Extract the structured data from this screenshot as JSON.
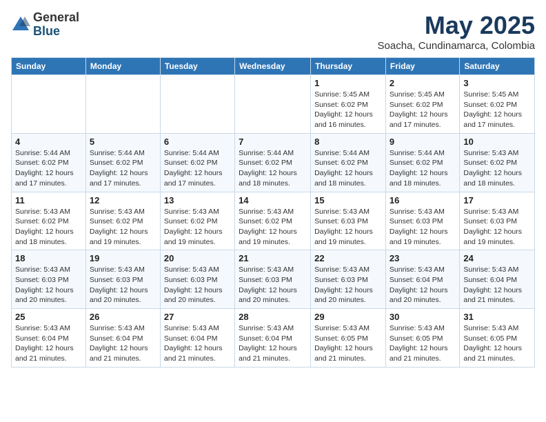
{
  "header": {
    "logo_general": "General",
    "logo_blue": "Blue",
    "month_title": "May 2025",
    "subtitle": "Soacha, Cundinamarca, Colombia"
  },
  "weekdays": [
    "Sunday",
    "Monday",
    "Tuesday",
    "Wednesday",
    "Thursday",
    "Friday",
    "Saturday"
  ],
  "weeks": [
    [
      {
        "day": "",
        "info": ""
      },
      {
        "day": "",
        "info": ""
      },
      {
        "day": "",
        "info": ""
      },
      {
        "day": "",
        "info": ""
      },
      {
        "day": "1",
        "info": "Sunrise: 5:45 AM\nSunset: 6:02 PM\nDaylight: 12 hours\nand 16 minutes."
      },
      {
        "day": "2",
        "info": "Sunrise: 5:45 AM\nSunset: 6:02 PM\nDaylight: 12 hours\nand 17 minutes."
      },
      {
        "day": "3",
        "info": "Sunrise: 5:45 AM\nSunset: 6:02 PM\nDaylight: 12 hours\nand 17 minutes."
      }
    ],
    [
      {
        "day": "4",
        "info": "Sunrise: 5:44 AM\nSunset: 6:02 PM\nDaylight: 12 hours\nand 17 minutes."
      },
      {
        "day": "5",
        "info": "Sunrise: 5:44 AM\nSunset: 6:02 PM\nDaylight: 12 hours\nand 17 minutes."
      },
      {
        "day": "6",
        "info": "Sunrise: 5:44 AM\nSunset: 6:02 PM\nDaylight: 12 hours\nand 17 minutes."
      },
      {
        "day": "7",
        "info": "Sunrise: 5:44 AM\nSunset: 6:02 PM\nDaylight: 12 hours\nand 18 minutes."
      },
      {
        "day": "8",
        "info": "Sunrise: 5:44 AM\nSunset: 6:02 PM\nDaylight: 12 hours\nand 18 minutes."
      },
      {
        "day": "9",
        "info": "Sunrise: 5:44 AM\nSunset: 6:02 PM\nDaylight: 12 hours\nand 18 minutes."
      },
      {
        "day": "10",
        "info": "Sunrise: 5:43 AM\nSunset: 6:02 PM\nDaylight: 12 hours\nand 18 minutes."
      }
    ],
    [
      {
        "day": "11",
        "info": "Sunrise: 5:43 AM\nSunset: 6:02 PM\nDaylight: 12 hours\nand 18 minutes."
      },
      {
        "day": "12",
        "info": "Sunrise: 5:43 AM\nSunset: 6:02 PM\nDaylight: 12 hours\nand 19 minutes."
      },
      {
        "day": "13",
        "info": "Sunrise: 5:43 AM\nSunset: 6:02 PM\nDaylight: 12 hours\nand 19 minutes."
      },
      {
        "day": "14",
        "info": "Sunrise: 5:43 AM\nSunset: 6:02 PM\nDaylight: 12 hours\nand 19 minutes."
      },
      {
        "day": "15",
        "info": "Sunrise: 5:43 AM\nSunset: 6:03 PM\nDaylight: 12 hours\nand 19 minutes."
      },
      {
        "day": "16",
        "info": "Sunrise: 5:43 AM\nSunset: 6:03 PM\nDaylight: 12 hours\nand 19 minutes."
      },
      {
        "day": "17",
        "info": "Sunrise: 5:43 AM\nSunset: 6:03 PM\nDaylight: 12 hours\nand 19 minutes."
      }
    ],
    [
      {
        "day": "18",
        "info": "Sunrise: 5:43 AM\nSunset: 6:03 PM\nDaylight: 12 hours\nand 20 minutes."
      },
      {
        "day": "19",
        "info": "Sunrise: 5:43 AM\nSunset: 6:03 PM\nDaylight: 12 hours\nand 20 minutes."
      },
      {
        "day": "20",
        "info": "Sunrise: 5:43 AM\nSunset: 6:03 PM\nDaylight: 12 hours\nand 20 minutes."
      },
      {
        "day": "21",
        "info": "Sunrise: 5:43 AM\nSunset: 6:03 PM\nDaylight: 12 hours\nand 20 minutes."
      },
      {
        "day": "22",
        "info": "Sunrise: 5:43 AM\nSunset: 6:03 PM\nDaylight: 12 hours\nand 20 minutes."
      },
      {
        "day": "23",
        "info": "Sunrise: 5:43 AM\nSunset: 6:04 PM\nDaylight: 12 hours\nand 20 minutes."
      },
      {
        "day": "24",
        "info": "Sunrise: 5:43 AM\nSunset: 6:04 PM\nDaylight: 12 hours\nand 21 minutes."
      }
    ],
    [
      {
        "day": "25",
        "info": "Sunrise: 5:43 AM\nSunset: 6:04 PM\nDaylight: 12 hours\nand 21 minutes."
      },
      {
        "day": "26",
        "info": "Sunrise: 5:43 AM\nSunset: 6:04 PM\nDaylight: 12 hours\nand 21 minutes."
      },
      {
        "day": "27",
        "info": "Sunrise: 5:43 AM\nSunset: 6:04 PM\nDaylight: 12 hours\nand 21 minutes."
      },
      {
        "day": "28",
        "info": "Sunrise: 5:43 AM\nSunset: 6:04 PM\nDaylight: 12 hours\nand 21 minutes."
      },
      {
        "day": "29",
        "info": "Sunrise: 5:43 AM\nSunset: 6:05 PM\nDaylight: 12 hours\nand 21 minutes."
      },
      {
        "day": "30",
        "info": "Sunrise: 5:43 AM\nSunset: 6:05 PM\nDaylight: 12 hours\nand 21 minutes."
      },
      {
        "day": "31",
        "info": "Sunrise: 5:43 AM\nSunset: 6:05 PM\nDaylight: 12 hours\nand 21 minutes."
      }
    ]
  ]
}
